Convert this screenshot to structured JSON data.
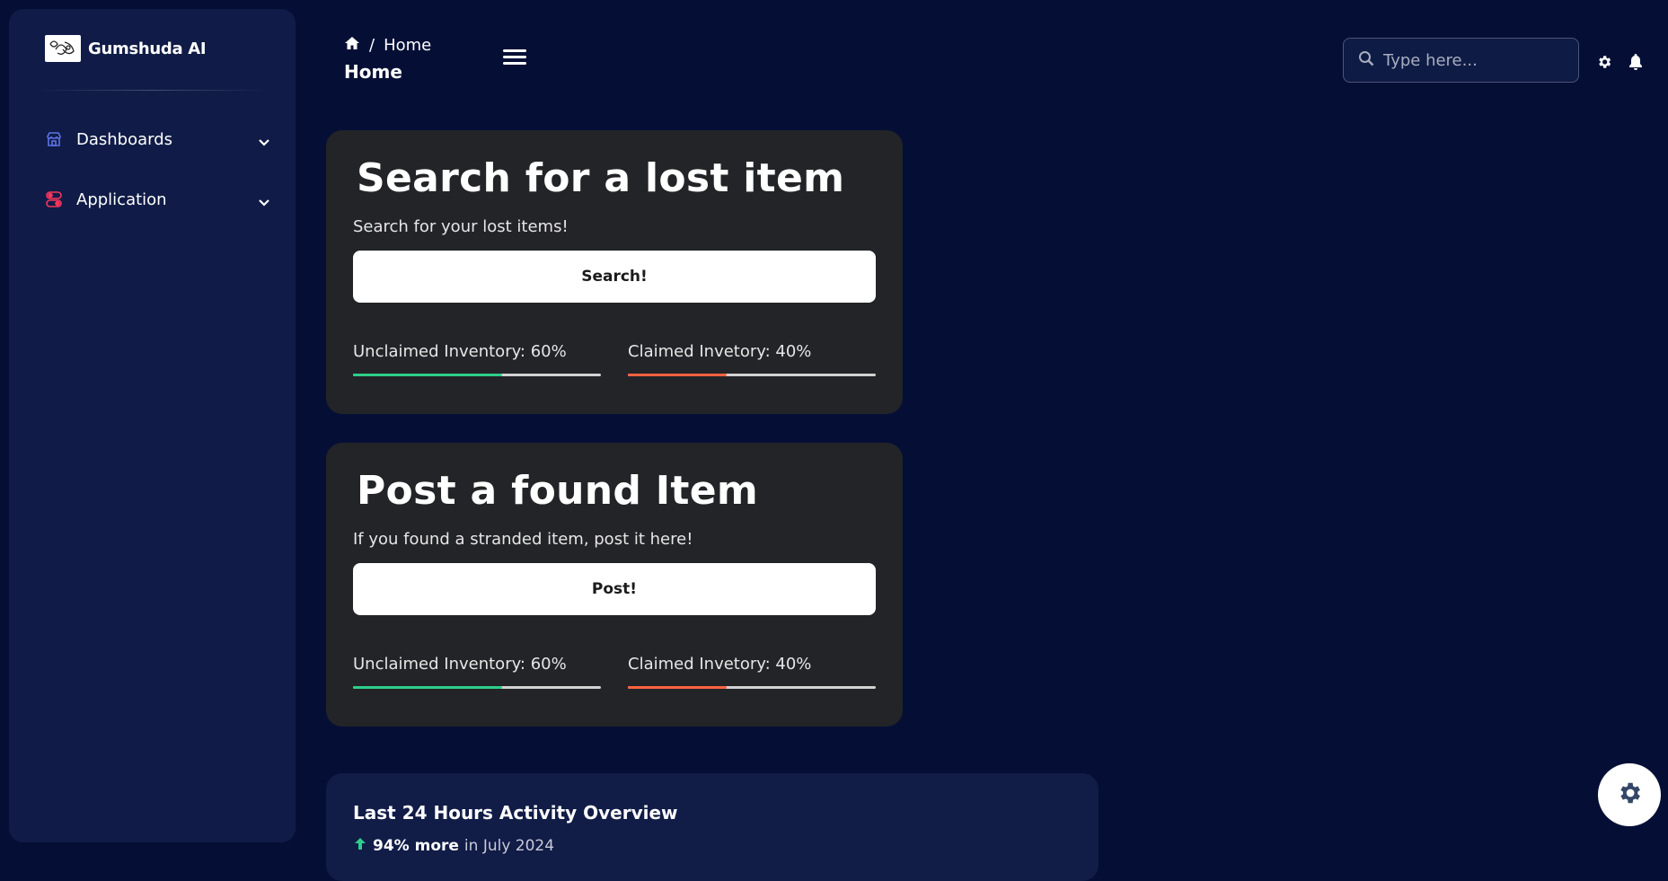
{
  "sidebar": {
    "brand": {
      "name": "Gumshuda AI"
    },
    "items": [
      {
        "label": "Dashboards",
        "icon": "shop-icon",
        "color": "#5e72e4"
      },
      {
        "label": "Application",
        "icon": "toggles-icon",
        "color": "#f5365c"
      }
    ]
  },
  "header": {
    "breadcrumb": {
      "current": "Home",
      "separator": "/"
    },
    "title": "Home",
    "search": {
      "placeholder": "Type here..."
    }
  },
  "cards": [
    {
      "title": "Search for a lost item",
      "subtitle": "Search for your lost items!",
      "button": "Search!",
      "stats": [
        {
          "label": "Unclaimed Inventory: 60%",
          "value": 60,
          "color": "#2dce89"
        },
        {
          "label": "Claimed Invetory: 40%",
          "value": 40,
          "color": "#fb6340"
        }
      ]
    },
    {
      "title": "Post a found Item",
      "subtitle": "If you found a stranded item, post it here!",
      "button": "Post!",
      "stats": [
        {
          "label": "Unclaimed Inventory: 60%",
          "value": 60,
          "color": "#2dce89"
        },
        {
          "label": "Claimed Invetory: 40%",
          "value": 40,
          "color": "#fb6340"
        }
      ]
    }
  ],
  "activity": {
    "title": "Last 24 Hours Activity Overview",
    "trend_value": "94% more",
    "trend_period": "in July 2024"
  }
}
